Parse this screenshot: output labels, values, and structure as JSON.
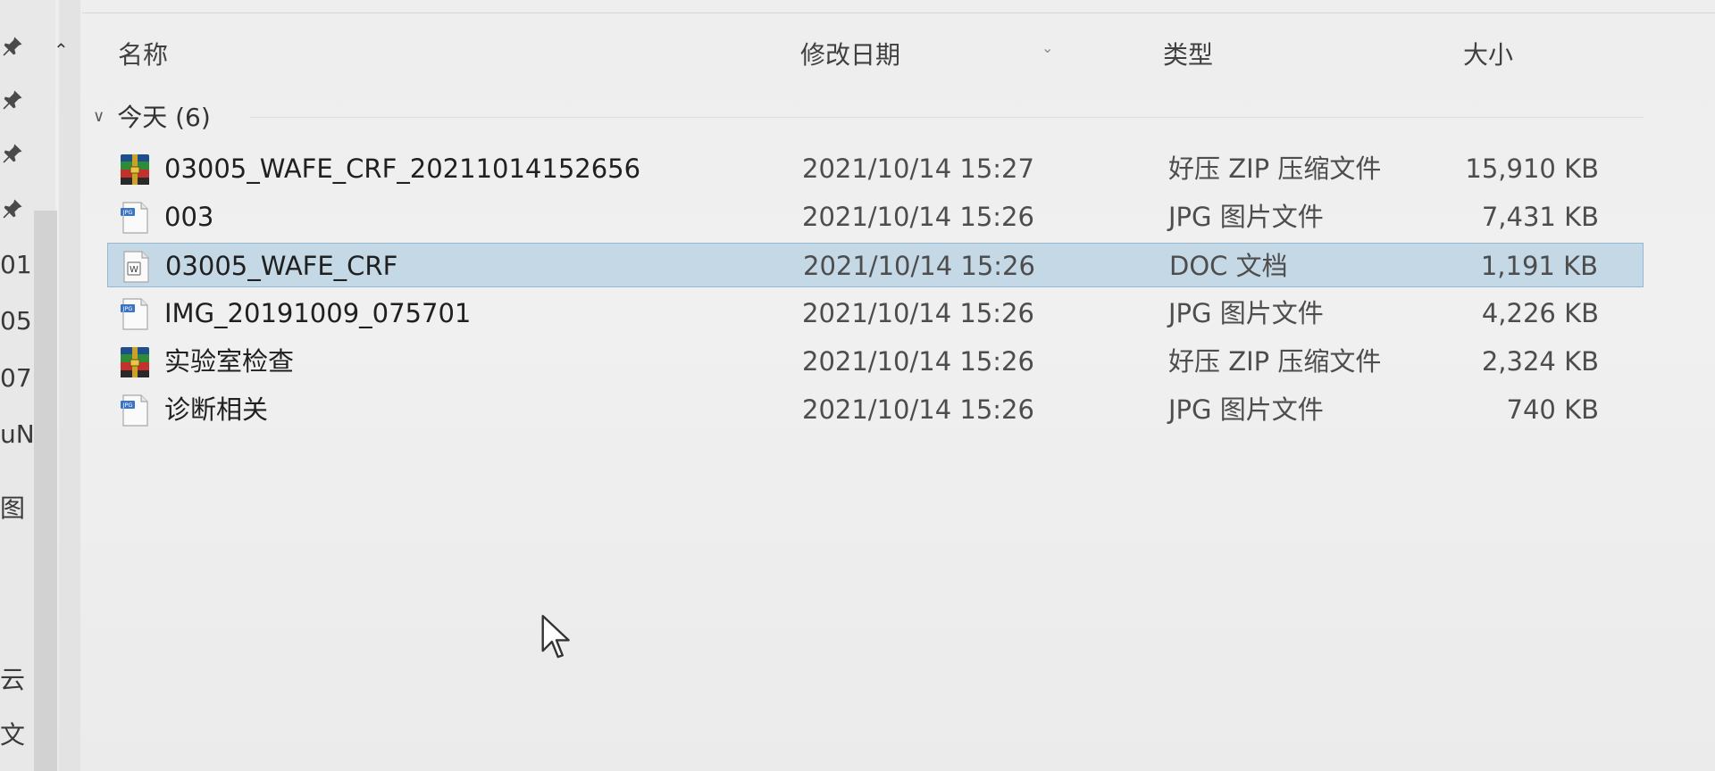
{
  "window": {
    "title": ""
  },
  "nav": {
    "scroll_up_icon": "chevron-up-icon",
    "pinned_icon": "pin-icon",
    "partial_labels": [
      "01",
      "05",
      "07",
      "uN",
      "图",
      "云",
      "文"
    ]
  },
  "columns": {
    "name": "名称",
    "date": "修改日期",
    "type": "类型",
    "size": "大小",
    "sort_icon": "chevron-down-icon"
  },
  "group": {
    "label": "今天 (6)",
    "expanded": true
  },
  "files": [
    {
      "name": "03005_WAFE_CRF_20211014152656",
      "date": "2021/10/14 15:27",
      "type": "好压 ZIP 压缩文件",
      "size": "15,910 KB",
      "icon": "zip-archive-icon",
      "selected": false
    },
    {
      "name": "003",
      "date": "2021/10/14 15:26",
      "type": "JPG 图片文件",
      "size": "7,431 KB",
      "icon": "jpg-file-icon",
      "selected": false
    },
    {
      "name": "03005_WAFE_CRF",
      "date": "2021/10/14 15:26",
      "type": "DOC 文档",
      "size": "1,191 KB",
      "icon": "word-document-icon",
      "selected": true
    },
    {
      "name": "IMG_20191009_075701",
      "date": "2021/10/14 15:26",
      "type": "JPG 图片文件",
      "size": "4,226 KB",
      "icon": "jpg-file-icon",
      "selected": false
    },
    {
      "name": "实验室检查",
      "date": "2021/10/14 15:26",
      "type": "好压 ZIP 压缩文件",
      "size": "2,324 KB",
      "icon": "zip-archive-icon",
      "selected": false
    },
    {
      "name": "诊断相关",
      "date": "2021/10/14 15:26",
      "type": "JPG 图片文件",
      "size": "740 KB",
      "icon": "jpg-file-icon",
      "selected": false
    }
  ],
  "colors": {
    "selection": "#a2c4de",
    "selection_border": "#96b9d3",
    "background": "#eeeeee"
  }
}
